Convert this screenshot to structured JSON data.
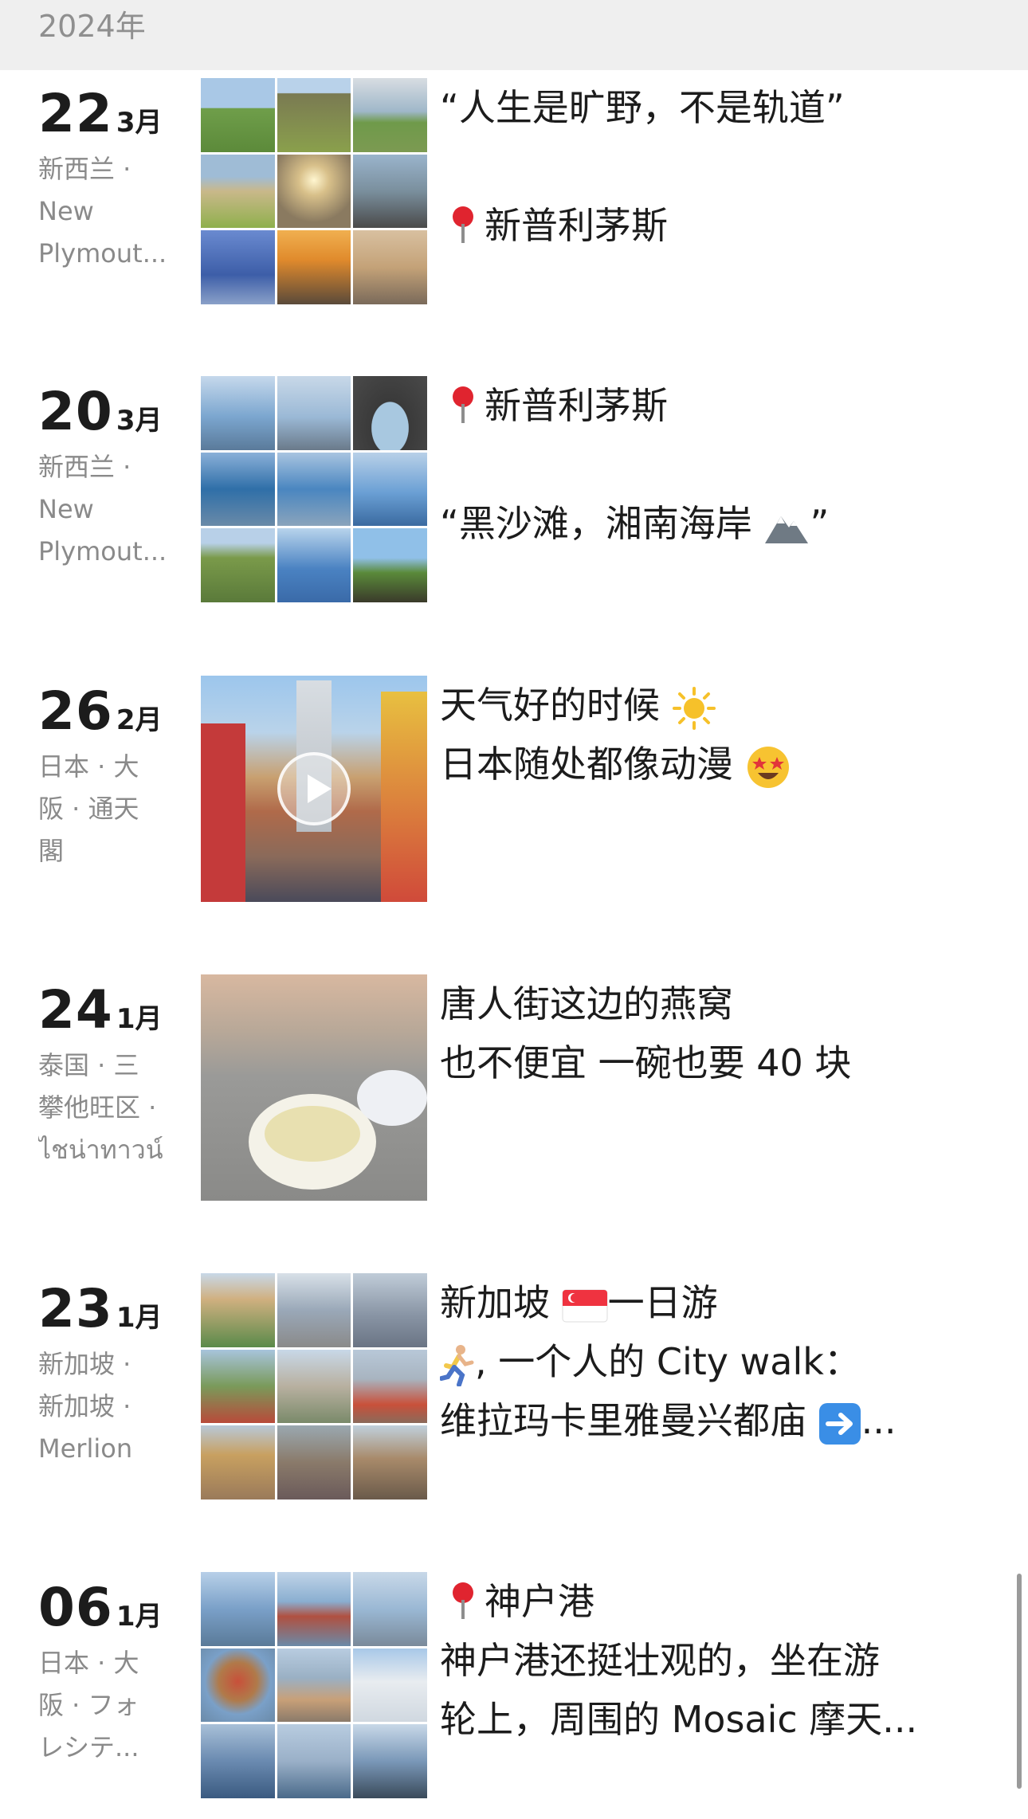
{
  "header": {
    "year": "2024年"
  },
  "entries": [
    {
      "day": "22",
      "month": "3月",
      "location": [
        "新西兰 ·",
        "New",
        "Plymout..."
      ],
      "text": [
        "“人生是旷野，不是轨道”",
        "",
        "新普利茅斯"
      ],
      "photo_colors": [
        "#6f9e4a",
        "#7a8a52",
        "#9fb7c9",
        "#8fb04c",
        "#c9a86a",
        "#7a8f9d",
        "#3d5ea8",
        "#e08a2c",
        "#c4a278"
      ]
    },
    {
      "day": "20",
      "month": "3月",
      "location": [
        "新西兰 ·",
        "New",
        "Plymout..."
      ],
      "text": [
        "新普利茅斯",
        "",
        "“黑沙滩，湘南海岸",
        "”"
      ],
      "photo_colors": [
        "#7ba6cf",
        "#9bb9d6",
        "#4a4a4a",
        "#2f6fa8",
        "#4a86c0",
        "#6a9fd4",
        "#7a9a4a",
        "#4a82c2",
        "#5a8a3a"
      ]
    },
    {
      "day": "26",
      "month": "2月",
      "location": [
        "日本 · 大",
        "阪 · 通天",
        "閣"
      ],
      "text": [
        "天气好的时候",
        "日本随处都像动漫"
      ],
      "photo_colors": [
        "#b08a6a"
      ]
    },
    {
      "day": "24",
      "month": "1月",
      "location": [
        "泰国 · 三",
        "攀他旺区 ·",
        "ไชน่าทาวน์"
      ],
      "text": [
        "唐人街这边的燕窝",
        "也不便宜 一碗也要 40 块"
      ],
      "photo_colors": [
        "#9a9a98"
      ]
    },
    {
      "day": "23",
      "month": "1月",
      "location": [
        "新加坡 ·",
        "新加坡 ·",
        "Merlion"
      ],
      "text": [
        "新加坡",
        "一日游",
        ", 一个人的 City walk：",
        "维拉玛卡里雅曼兴都庙",
        "..."
      ],
      "photo_colors": [
        "#5a8a4a",
        "#9aa8b8",
        "#8a96a6",
        "#7a9a5a",
        "#b8b0a0",
        "#a8b4c0",
        "#9a7a5a",
        "#8a7a6a",
        "#a88a6a"
      ]
    },
    {
      "day": "06",
      "month": "1月",
      "location": [
        "日本 · 大",
        "阪 · フォ",
        "レシテ..."
      ],
      "text": [
        "神户港",
        "神户港还挺壮观的，坐在游",
        "轮上，周围的 Mosaic 摩天..."
      ],
      "photo_colors": [
        "#7aa0c8",
        "#8aaed0",
        "#9ab8d4",
        "#b07a4a",
        "#9ab0c4",
        "#d0d8e0",
        "#6a8ab0",
        "#9ab0c8",
        "#7a98b8"
      ]
    }
  ]
}
